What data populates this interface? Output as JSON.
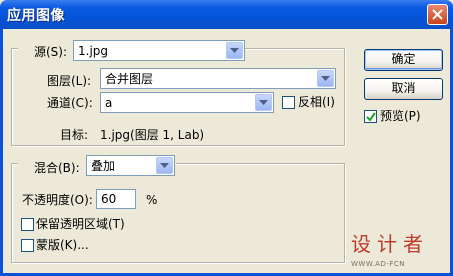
{
  "window": {
    "title": "应用图像"
  },
  "source_group": {
    "source_label": "源(S):",
    "source_value": "1.jpg",
    "layer_label": "图层(L):",
    "layer_value": "合并图层",
    "channel_label": "通道(C):",
    "channel_value": "a",
    "invert_label": "反相(I)",
    "invert_checked": false
  },
  "target": {
    "label": "目标:",
    "value": "1.jpg(图层 1, Lab)"
  },
  "blend_group": {
    "blend_label": "混合(B):",
    "blend_value": "叠加",
    "opacity_label": "不透明度(O):",
    "opacity_value": "60",
    "opacity_unit": "%",
    "preserve_label": "保留透明区域(T)",
    "preserve_checked": false,
    "mask_label": "蒙版(K)...",
    "mask_checked": false
  },
  "buttons": {
    "ok": "确定",
    "cancel": "取消"
  },
  "preview": {
    "label": "预览(P)",
    "checked": true
  },
  "watermark": {
    "text": "设计者",
    "url": "WWW.AD-FCN"
  }
}
